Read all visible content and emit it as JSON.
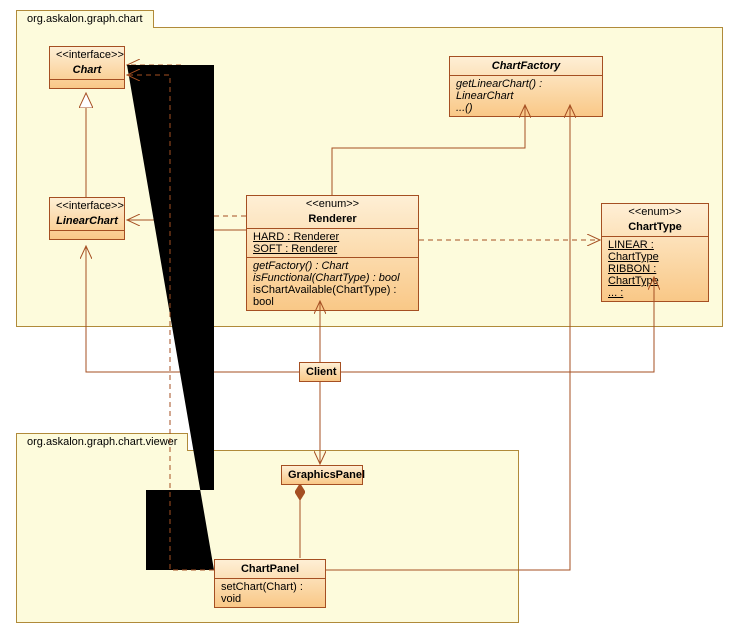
{
  "packages": {
    "chart": {
      "name": "org.askalon.graph.chart"
    },
    "viewer": {
      "name": "org.askalon.graph.chart.viewer"
    }
  },
  "classes": {
    "chart": {
      "stereotype": "<<interface>>",
      "name": "Chart"
    },
    "chartFactory": {
      "name": "ChartFactory",
      "ops": [
        "getLinearChart() : LinearChart",
        "...()"
      ]
    },
    "linearChart": {
      "stereotype": "<<interface>>",
      "name": "LinearChart"
    },
    "renderer": {
      "stereotype": "<<enum>>",
      "name": "Renderer",
      "attrs": [
        "HARD : Renderer",
        "SOFT : Renderer"
      ],
      "ops": [
        "getFactory() : Chart",
        "isFunctional(ChartType) : bool",
        "isChartAvailable(ChartType) : bool"
      ]
    },
    "chartType": {
      "stereotype": "<<enum>>",
      "name": "ChartType",
      "attrs": [
        "LINEAR : ChartType",
        "RIBBON : ChartType",
        "... :"
      ]
    },
    "client": {
      "name": "Client"
    },
    "graphicsPanel": {
      "name": "GraphicsPanel"
    },
    "chartPanel": {
      "name": "ChartPanel",
      "ops": [
        "setChart(Chart) : void"
      ]
    }
  }
}
